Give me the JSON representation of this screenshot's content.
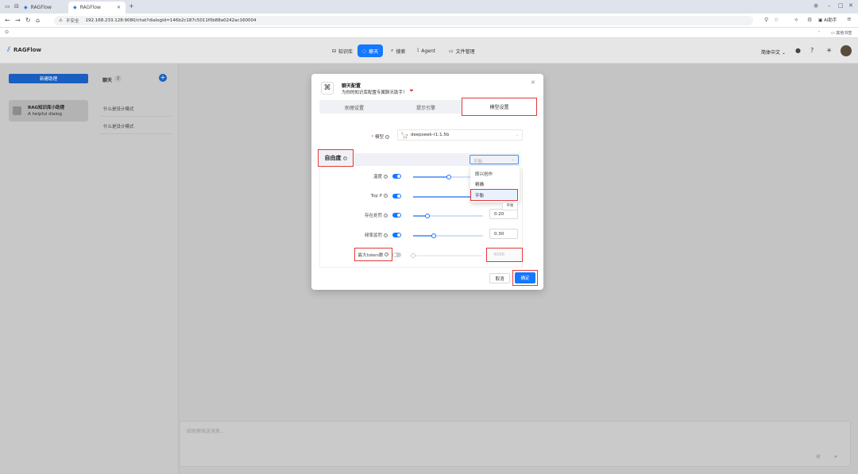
{
  "browser": {
    "tabs": [
      {
        "label": "RAGFlow"
      },
      {
        "label": "RAGFlow"
      }
    ],
    "security_label": "不安全",
    "url": "192.168.233.128:9080/chat?dialogId=146b2c187c5011f0b88a0242ac160004",
    "ai_button": "AI助手",
    "bookmarks": "其他书签"
  },
  "app": {
    "logo": "RAGFlow",
    "nav": [
      {
        "label": "知识库",
        "icon": "database-icon"
      },
      {
        "label": "聊天",
        "icon": "chat-icon"
      },
      {
        "label": "搜索",
        "icon": "search-icon"
      },
      {
        "label": "Agent",
        "icon": "agent-icon"
      },
      {
        "label": "文件管理",
        "icon": "folder-icon"
      }
    ],
    "language": "简体中文"
  },
  "sidebar": {
    "new_assistant": "新建助理",
    "assistant_name": "RAG知识库小助理",
    "assistant_desc": "A helpful dialog"
  },
  "chats": {
    "title": "聊天",
    "count": "2",
    "items": [
      "什么是设计模式",
      "什么是设计模式"
    ]
  },
  "input": {
    "placeholder": "给助理发送消息..."
  },
  "modal": {
    "title": "聊天配置",
    "subtitle": "为你的知识库配置专属聊天助手！",
    "tabs": [
      "助理设置",
      "提示引擎",
      "模型设置"
    ],
    "model_label": "模型",
    "model_value": "deepseek-r1:1.5b",
    "freedom_label": "自由度",
    "freedom_value": "平衡",
    "freedom_options": [
      "即兴创作",
      "精确",
      "平衡"
    ],
    "tooltip": "平衡",
    "params": [
      {
        "label": "温度",
        "enabled": true,
        "value": 0.5,
        "display": ""
      },
      {
        "label": "Top P",
        "enabled": true,
        "value": 0.85,
        "display": ""
      },
      {
        "label": "存在处罚",
        "enabled": true,
        "value": 0.2,
        "display": "0.20"
      },
      {
        "label": "频率惩罚",
        "enabled": true,
        "value": 0.3,
        "display": "0.30"
      },
      {
        "label": "最大token数",
        "enabled": false,
        "value": 0,
        "display": "4096"
      }
    ],
    "cancel": "取消",
    "ok": "确定"
  }
}
